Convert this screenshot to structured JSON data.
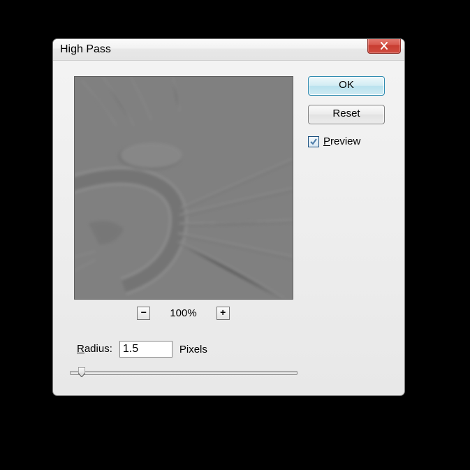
{
  "dialog": {
    "title": "High Pass",
    "zoom_level": "100%",
    "radius_label_prefix": "R",
    "radius_label_rest": "adius:",
    "radius_value": "1.5",
    "radius_unit": "Pixels",
    "ok_label": "OK",
    "reset_label": "Reset",
    "preview_label_prefix": "P",
    "preview_label_rest": "review",
    "preview_checked": true,
    "minus_label": "−",
    "plus_label": "+"
  }
}
